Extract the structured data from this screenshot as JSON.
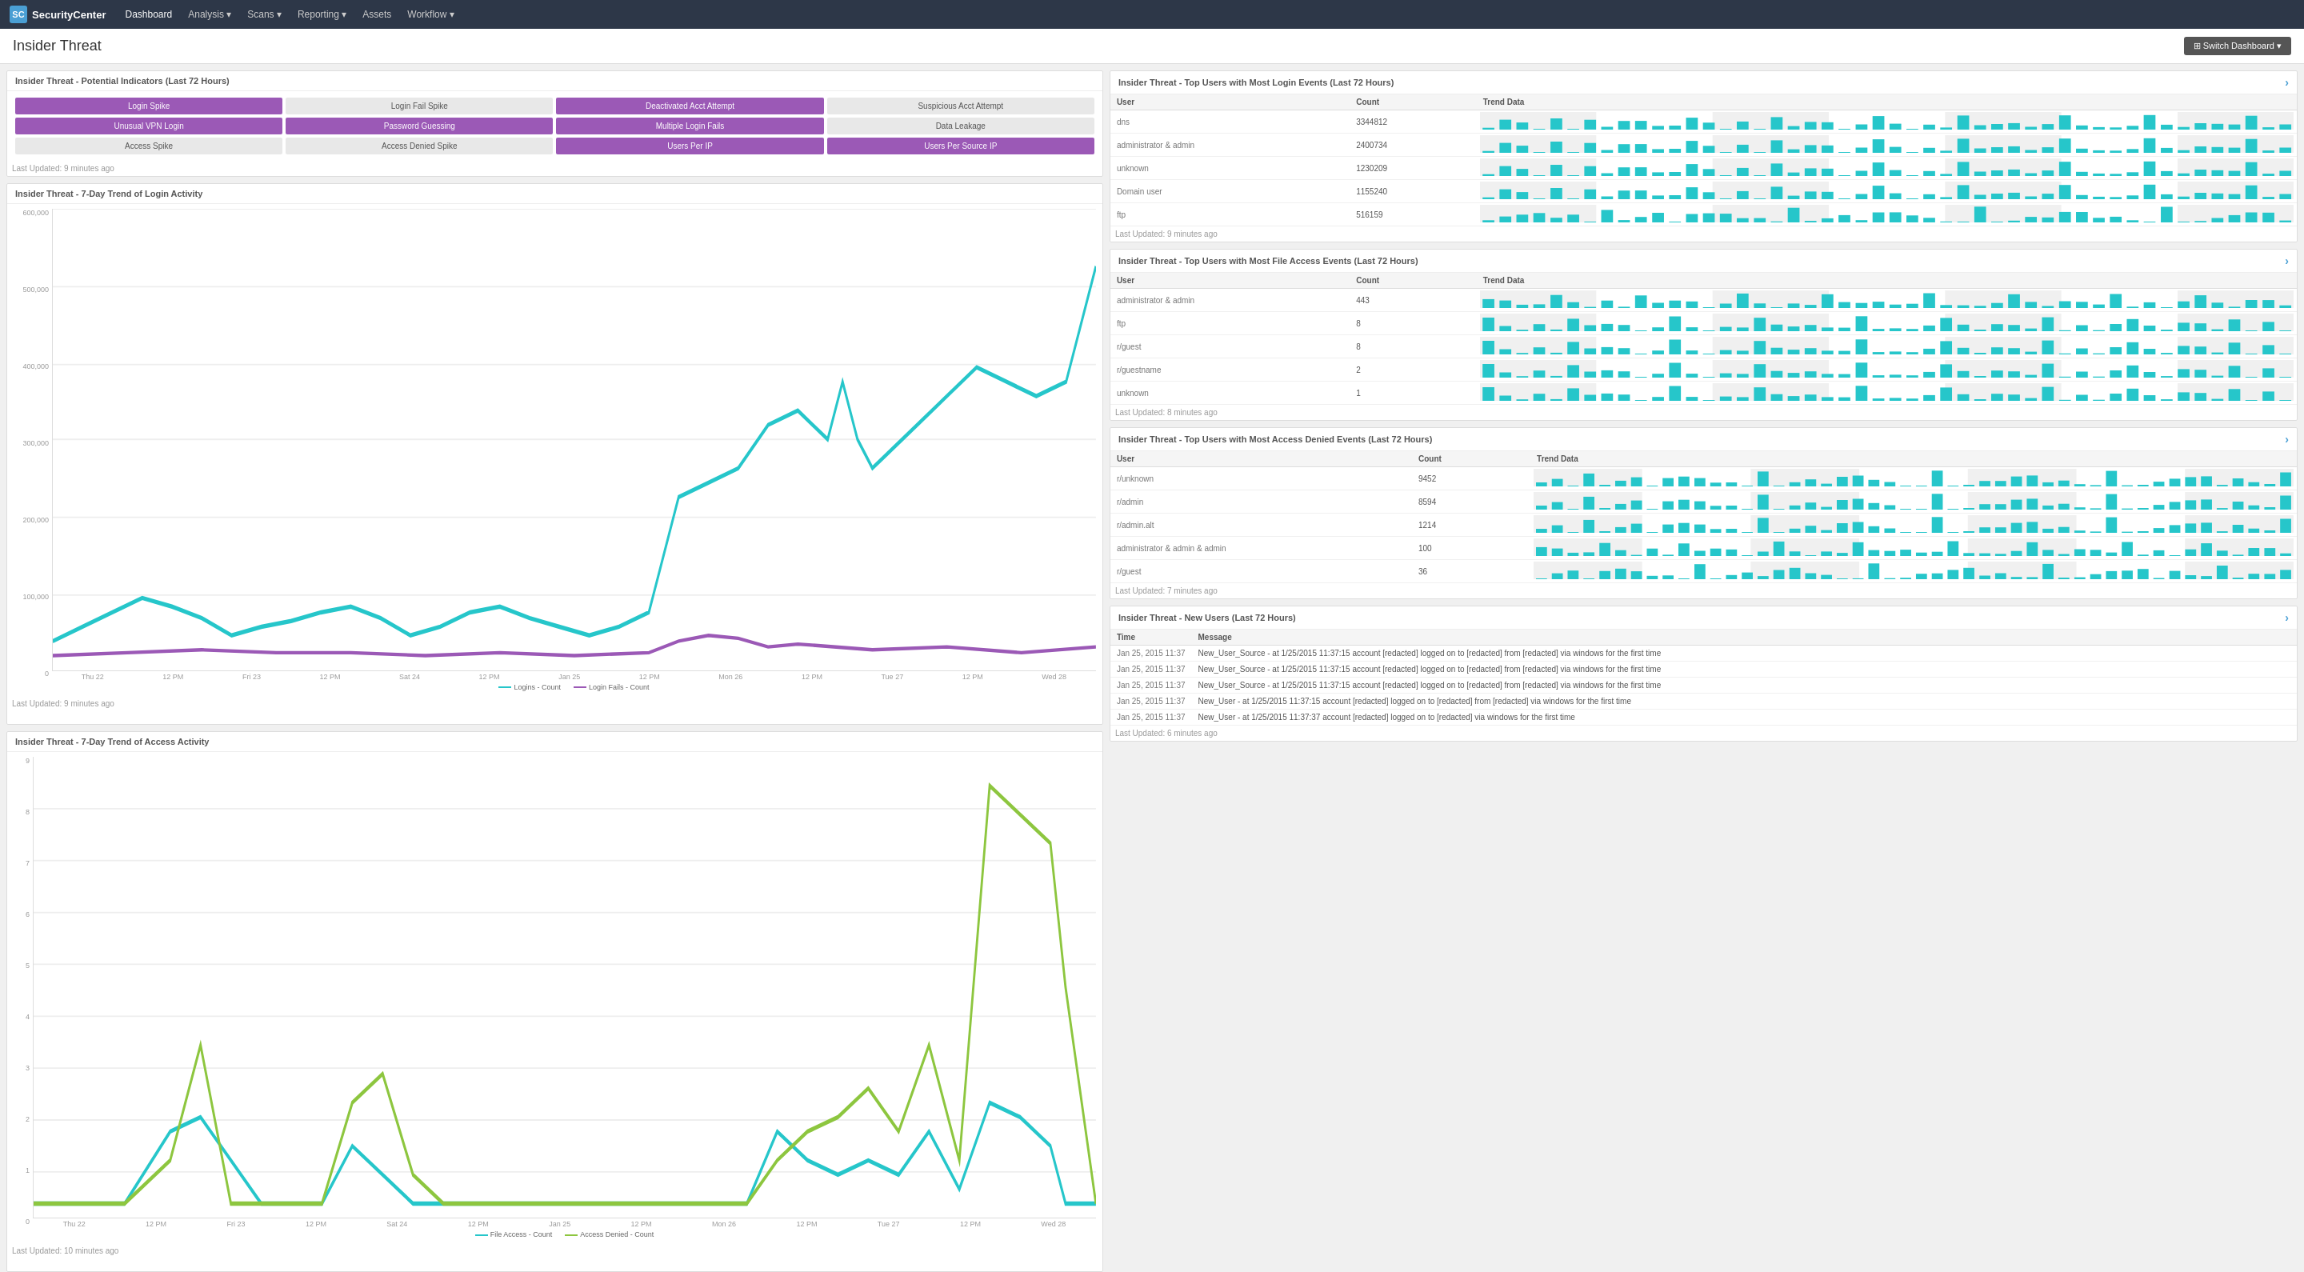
{
  "app": {
    "name": "SecurityCenter",
    "logo_text": "SC"
  },
  "nav": {
    "links": [
      {
        "label": "Dashboard",
        "active": true,
        "has_arrow": false
      },
      {
        "label": "Analysis",
        "active": false,
        "has_arrow": true
      },
      {
        "label": "Scans",
        "active": false,
        "has_arrow": true
      },
      {
        "label": "Reporting",
        "active": false,
        "has_arrow": true
      },
      {
        "label": "Assets",
        "active": false,
        "has_arrow": false
      },
      {
        "label": "Workflow",
        "active": false,
        "has_arrow": true
      }
    ]
  },
  "page": {
    "title": "Insider Threat",
    "switch_dashboard_label": "⊞ Switch Dashboard ▾"
  },
  "indicators": {
    "title": "Insider Threat - Potential Indicators (Last 72 Hours)",
    "buttons": [
      {
        "label": "Login Spike",
        "style": "purple"
      },
      {
        "label": "Login Fail Spike",
        "style": "gray"
      },
      {
        "label": "Deactivated Acct Attempt",
        "style": "purple"
      },
      {
        "label": "Suspicious Acct Attempt",
        "style": "gray"
      },
      {
        "label": "Unusual VPN Login",
        "style": "purple"
      },
      {
        "label": "Password Guessing",
        "style": "purple"
      },
      {
        "label": "Multiple Login Fails",
        "style": "purple"
      },
      {
        "label": "Data Leakage",
        "style": "gray"
      },
      {
        "label": "Access Spike",
        "style": "gray"
      },
      {
        "label": "Access Denied Spike",
        "style": "gray"
      },
      {
        "label": "Users Per IP",
        "style": "purple"
      },
      {
        "label": "Users Per Source IP",
        "style": "purple"
      }
    ],
    "last_updated": "Last Updated: 9 minutes ago"
  },
  "login_trend": {
    "title": "Insider Threat - 7-Day Trend of Login Activity",
    "y_labels": [
      "600,000",
      "500,000",
      "400,000",
      "300,000",
      "200,000",
      "100,000",
      "0"
    ],
    "x_labels": [
      "Thu 22",
      "12 PM",
      "Fri 23",
      "12 PM",
      "Sat 24",
      "12 PM",
      "Jan 25",
      "12 PM",
      "Mon 26",
      "12 PM",
      "Tue 27",
      "12 PM",
      "Wed 28"
    ],
    "legend": [
      {
        "label": "Logins - Count",
        "color": "#26c6ca"
      },
      {
        "label": "Login Fails - Count",
        "color": "#9b59b6"
      }
    ],
    "last_updated": "Last Updated: 9 minutes ago"
  },
  "access_trend": {
    "title": "Insider Threat - 7-Day Trend of Access Activity",
    "y_labels": [
      "9",
      "8",
      "7",
      "6",
      "5",
      "4",
      "3",
      "2",
      "1",
      "0"
    ],
    "x_labels": [
      "Thu 22",
      "12 PM",
      "Fri 23",
      "12 PM",
      "Sat 24",
      "12 PM",
      "Jan 25",
      "12 PM",
      "Mon 26",
      "12 PM",
      "Tue 27",
      "12 PM",
      "Wed 28"
    ],
    "legend": [
      {
        "label": "File Access - Count",
        "color": "#26c6ca"
      },
      {
        "label": "Access Denied - Count",
        "color": "#8dc63f"
      }
    ],
    "last_updated": "Last Updated: 10 minutes ago"
  },
  "top_login_users": {
    "title": "Insider Threat - Top Users with Most Login Events (Last 72 Hours)",
    "columns": [
      "User",
      "Count",
      "Trend Data"
    ],
    "rows": [
      {
        "user": "dns",
        "count": "3344812"
      },
      {
        "user": "administrator & admin",
        "count": "2400734"
      },
      {
        "user": "unknown",
        "count": "1230209"
      },
      {
        "user": "Domain user",
        "count": "1155240"
      },
      {
        "user": "ftp",
        "count": "516159"
      }
    ],
    "last_updated": "Last Updated: 9 minutes ago"
  },
  "top_file_users": {
    "title": "Insider Threat - Top Users with Most File Access Events (Last 72 Hours)",
    "columns": [
      "User",
      "Count",
      "Trend Data"
    ],
    "rows": [
      {
        "user": "administrator & admin",
        "count": "443"
      },
      {
        "user": "ftp",
        "count": "8"
      },
      {
        "user": "r/guest",
        "count": "8"
      },
      {
        "user": "r/guestname",
        "count": "2"
      },
      {
        "user": "unknown",
        "count": "1"
      }
    ],
    "last_updated": "Last Updated: 8 minutes ago"
  },
  "top_access_denied": {
    "title": "Insider Threat - Top Users with Most Access Denied Events (Last 72 Hours)",
    "columns": [
      "User",
      "Count",
      "Trend Data"
    ],
    "rows": [
      {
        "user": "r/unknown",
        "count": "9452"
      },
      {
        "user": "r/admin",
        "count": "8594"
      },
      {
        "user": "r/admin.alt",
        "count": "1214"
      },
      {
        "user": "administrator & admin & admin",
        "count": "100"
      },
      {
        "user": "r/guest",
        "count": "36"
      }
    ],
    "last_updated": "Last Updated: 7 minutes ago"
  },
  "new_users": {
    "title": "Insider Threat - New Users (Last 72 Hours)",
    "columns": [
      "Time",
      "Message"
    ],
    "rows": [
      {
        "time": "Jan 25, 2015 11:37",
        "message": "New_User_Source - at 1/25/2015 11:37:15 account [redacted] logged on to [redacted] from [redacted] via windows for the first time"
      },
      {
        "time": "Jan 25, 2015 11:37",
        "message": "New_User_Source - at 1/25/2015 11:37:15 account [redacted] logged on to [redacted] from [redacted] via windows for the first time"
      },
      {
        "time": "Jan 25, 2015 11:37",
        "message": "New_User_Source - at 1/25/2015 11:37:15 account [redacted] logged on to [redacted] from [redacted] via windows for the first time"
      },
      {
        "time": "Jan 25, 2015 11:37",
        "message": "New_User - at 1/25/2015 11:37:15 account [redacted] logged on to [redacted] from [redacted] via windows for the first time"
      },
      {
        "time": "Jan 25, 2015 11:37",
        "message": "New_User - at 1/25/2015 11:37:37 account [redacted] logged on to [redacted] via windows for the first time"
      }
    ],
    "last_updated": "Last Updated: 6 minutes ago"
  }
}
